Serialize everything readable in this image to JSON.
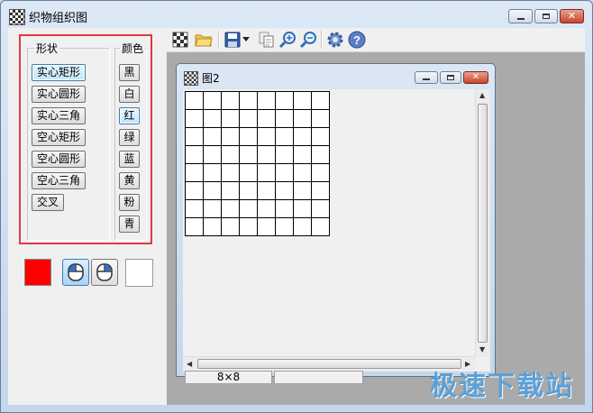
{
  "window": {
    "title": "织物组织图"
  },
  "shape_group": {
    "title": "形状",
    "buttons": [
      "实心矩形",
      "实心圆形",
      "实心三角",
      "空心矩形",
      "空心圆形",
      "空心三角",
      "交叉"
    ],
    "selected_index": 0
  },
  "color_group": {
    "title": "颜色",
    "buttons": [
      "黑",
      "白",
      "红",
      "绿",
      "蓝",
      "黄",
      "粉",
      "青"
    ],
    "selected_index": 2
  },
  "current_color": "#ff0000",
  "toolbar": {
    "icons": [
      "new-icon",
      "open-folder-icon",
      "save-icon",
      "dropdown-arrow-icon",
      "copy-icon",
      "zoom-in-icon",
      "zoom-out-icon",
      "settings-gear-icon",
      "help-icon"
    ]
  },
  "child_window": {
    "title": "图2",
    "grid_cols": 8,
    "grid_rows": 8,
    "status_size": "8×8"
  },
  "watermark": "极速下载站"
}
